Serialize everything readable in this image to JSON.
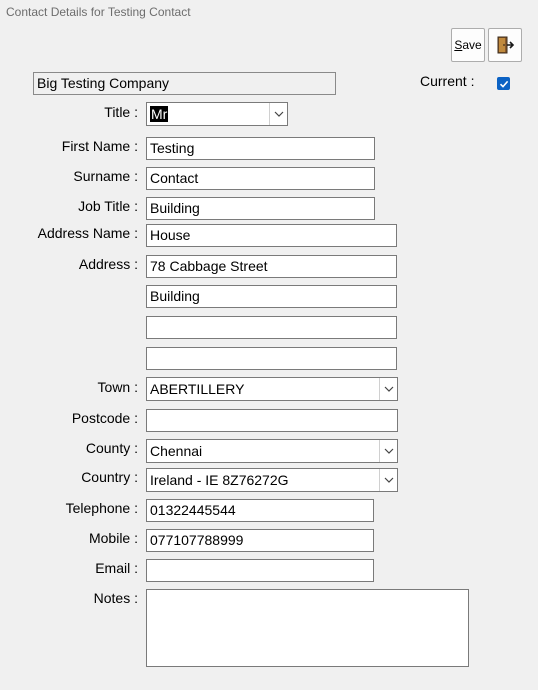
{
  "window": {
    "title": "Contact Details for Testing Contact"
  },
  "toolbar": {
    "save_label_underlined": "S",
    "save_label_rest": "ave",
    "exit_icon": "exit-door-icon"
  },
  "company": {
    "name": "Big Testing Company"
  },
  "current": {
    "label": "Current :",
    "checked": true
  },
  "labels": {
    "title": "Title :",
    "first_name": "First Name :",
    "surname": "Surname :",
    "job_title": "Job Title :",
    "address_name": "Address Name :",
    "address": "Address :",
    "town": "Town :",
    "postcode": "Postcode :",
    "county": "County :",
    "country": "Country :",
    "telephone": "Telephone :",
    "mobile": "Mobile :",
    "email": "Email :",
    "notes": "Notes :"
  },
  "values": {
    "title": "Mr",
    "first_name": "Testing",
    "surname": "Contact",
    "job_title": "Building",
    "address_name": "House",
    "address_line1": "78 Cabbage Street",
    "address_line2": "Building",
    "address_line3": "",
    "address_line4": "",
    "town": "ABERTILLERY",
    "postcode": "",
    "county": "Chennai",
    "country": "Ireland - IE 8Z76272G",
    "telephone": "01322445544",
    "mobile": "077107788999",
    "email": "",
    "notes": ""
  },
  "colors": {
    "accent": "#0b62c4",
    "background": "#f0f0f0",
    "field_border": "#7a7a7a"
  }
}
